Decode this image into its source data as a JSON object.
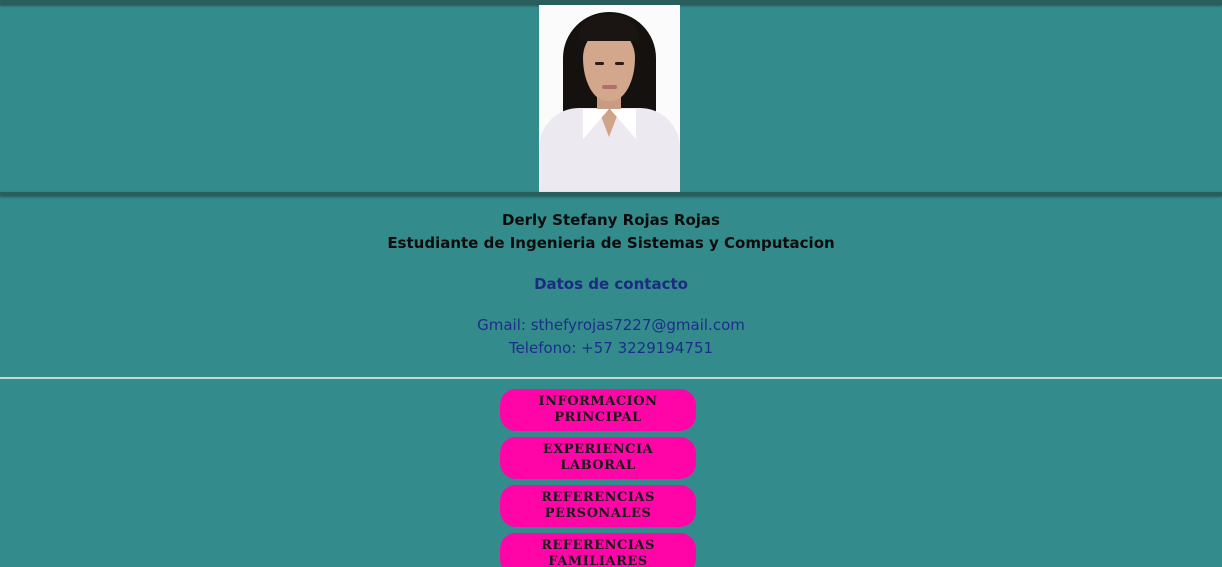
{
  "profile": {
    "photo_alt": "portrait-photo",
    "name": "Derly Stefany Rojas Rojas",
    "role": "Estudiante de Ingenieria de Sistemas y Computacion"
  },
  "contact": {
    "title": "Datos de contacto",
    "gmail": "Gmail: sthefyrojas7227@gmail.com",
    "phone": "Telefono: +57 3229194751"
  },
  "nav": {
    "items": [
      {
        "label": "INFORMACION\nPRINCIPAL"
      },
      {
        "label": "EXPERIENCIA\nLABORAL"
      },
      {
        "label": "REFERENCIAS\nPERSONALES"
      },
      {
        "label": "REFERENCIAS\nFAMILIARES"
      }
    ]
  },
  "colors": {
    "background": "#348b8b",
    "button": "#ff05a8",
    "contact_text": "#1d2e8a"
  }
}
